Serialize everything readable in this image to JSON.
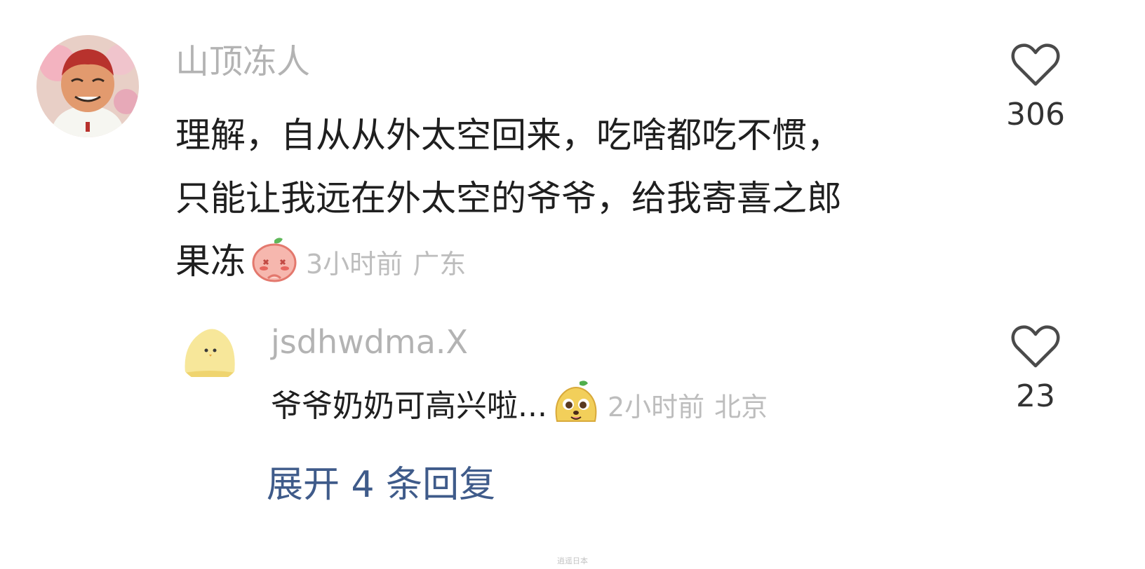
{
  "comment": {
    "username": "山顶冻人",
    "text_lines": [
      "理解，自从从外太空回来，吃啥都吃不惯，",
      "只能让我远在外太空的爷爷，给我寄喜之郎",
      "果冻"
    ],
    "emoji_icon": "peach-blushing-emoji",
    "time": "3小时前",
    "location": "广东",
    "like_icon": "heart-outline-icon",
    "like_count": "306"
  },
  "reply": {
    "username": "jsdhwdma.X",
    "text": "爷爷奶奶可高兴啦...",
    "emoji_icon": "yellow-pear-dog-emoji",
    "time": "2小时前",
    "location": "北京",
    "like_icon": "heart-outline-icon",
    "like_count": "23"
  },
  "expand_replies_label": "展开 4 条回复",
  "watermark": "逍遥日本",
  "colors": {
    "username": "#b3b3b3",
    "text": "#1f1f1f",
    "meta": "#bdbdbd",
    "link": "#3f5b8a",
    "like_count": "#333333"
  }
}
